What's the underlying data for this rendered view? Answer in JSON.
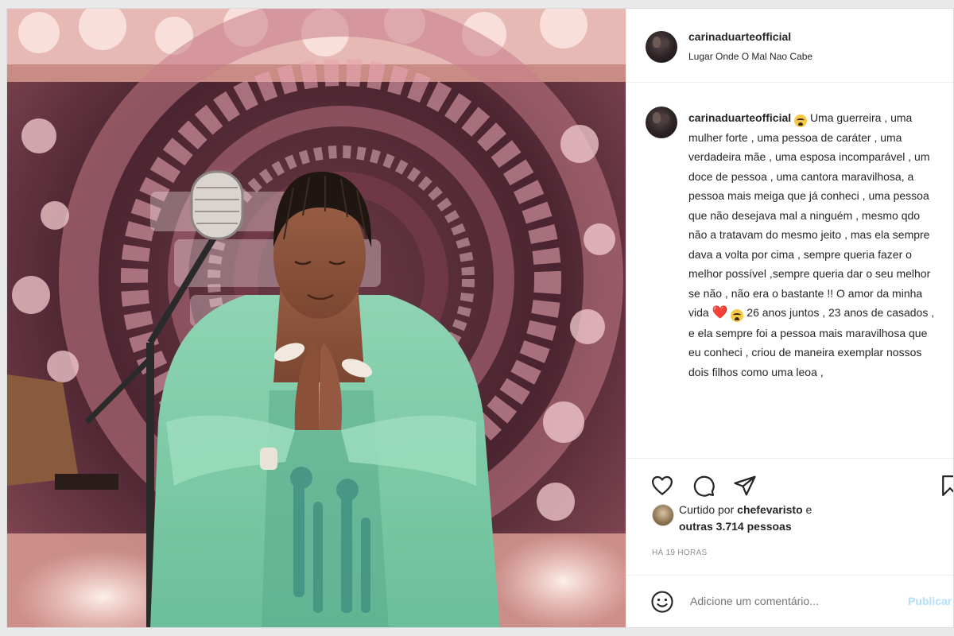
{
  "post": {
    "username": "carinaduarteofficial",
    "location": "Lugar Onde O Mal Nao Cabe"
  },
  "caption": {
    "username": "carinaduarteofficial",
    "emoji1": "😭",
    "text1": "Uma guerreira , uma mulher forte , uma pessoa de caráter , uma verdadeira mãe , uma esposa incomparável , um doce de pessoa , uma cantora maravilhosa, a pessoa mais meiga que já conheci , uma pessoa que não desejava mal a ninguém , mesmo qdo não a tratavam do mesmo jeito , mas ela sempre dava a volta por cima , sempre queria fazer o melhor possível ,sempre queria dar o seu melhor se não , não era o bastante !! O amor da minha vida",
    "heart": "❤️",
    "emoji2": "😭",
    "text2": "26 anos juntos , 23 anos de casados , e ela sempre foi a pessoa mais maravilhosa que eu conheci , criou de maneira exemplar nossos dois filhos como uma leoa ,"
  },
  "actions": {
    "icons": [
      "heart-icon",
      "comment-icon",
      "share-icon",
      "bookmark-icon"
    ]
  },
  "likes": {
    "prefix": "Curtido por",
    "user": "chefevaristo",
    "joiner": "e",
    "others": "outras 3.714 pessoas"
  },
  "timestamp": "HÁ 19 HORAS",
  "comment": {
    "placeholder": "Adicione um comentário...",
    "publish_label": "Publicar"
  },
  "colors": {
    "text": "#262626",
    "muted": "#8e8e8e",
    "link": "#b2dffc",
    "dress": "#7cc9a6",
    "background_pink": "#e7a3ac"
  }
}
